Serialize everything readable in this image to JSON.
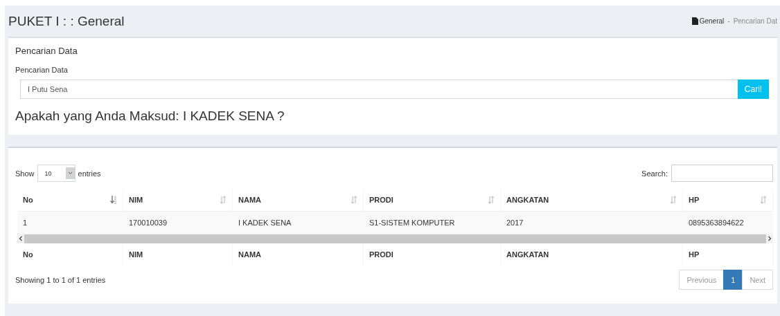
{
  "header": {
    "title": "PUKET I : : General",
    "breadcrumb": [
      {
        "label": "General",
        "kind": "home"
      },
      {
        "label": "-",
        "kind": "separator"
      },
      {
        "label": "Pencarian Dat",
        "kind": "current"
      }
    ]
  },
  "search_card": {
    "title": "Pencarian Data",
    "field_label": "Pencarian Data",
    "value": "I Putu Sena",
    "button": "Cari!",
    "suggestion": "Apakah yang Anda Maksud: I KADEK SENA ?"
  },
  "table_card": {
    "length": {
      "prefix": "Show",
      "value": "10",
      "suffix": "entries"
    },
    "search_label": "Search:",
    "columns": [
      {
        "label": "No",
        "sorted": true
      },
      {
        "label": "NIM",
        "sorted": false
      },
      {
        "label": "NAMA",
        "sorted": false
      },
      {
        "label": "PRODI",
        "sorted": false
      },
      {
        "label": "ANGKATAN",
        "sorted": false
      },
      {
        "label": "HP",
        "sorted": false
      }
    ],
    "rows": [
      [
        "1",
        "170010039",
        "I KADEK SENA",
        "S1-SISTEM KOMPUTER",
        "2017",
        "0895363894622"
      ]
    ],
    "footer_columns": [
      "No",
      "NIM",
      "NAMA",
      "PRODI",
      "ANGKATAN",
      "HP"
    ],
    "info": "Showing 1 to 1 of 1 entries",
    "pagination": [
      {
        "label": "Previous",
        "selected": false
      },
      {
        "label": "1",
        "selected": true
      },
      {
        "label": "Next",
        "selected": false
      }
    ]
  }
}
